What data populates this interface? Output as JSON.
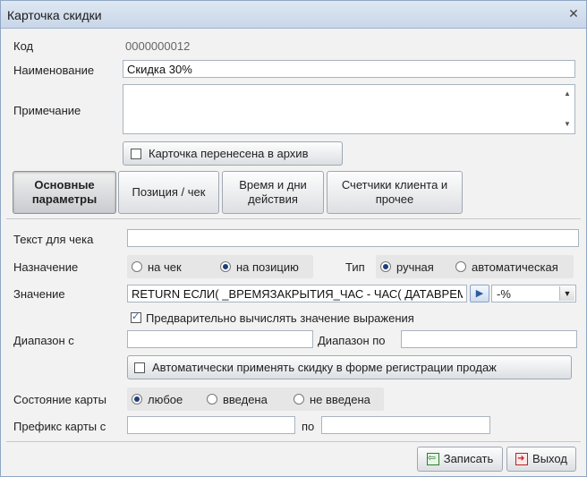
{
  "window": {
    "title": "Карточка скидки",
    "close": "✕"
  },
  "fields": {
    "code_label": "Код",
    "code_value": "0000000012",
    "name_label": "Наименование",
    "name_value": "Скидка 30%",
    "note_label": "Примечание",
    "archive_label": "Карточка перенесена в архив",
    "archive_checked": false
  },
  "tabs": [
    {
      "label": "Основные параметры",
      "active": true
    },
    {
      "label": "Позиция / чек",
      "active": false
    },
    {
      "label": "Время и дни действия",
      "active": false
    },
    {
      "label": "Счетчики клиента и прочее",
      "active": false
    }
  ],
  "params": {
    "receipt_text_label": "Текст для чека",
    "receipt_text_value": "",
    "purpose_label": "Назначение",
    "purpose_options": [
      "на чек",
      "на позицию"
    ],
    "purpose_selected": 1,
    "type_label": "Тип",
    "type_options": [
      "ручная",
      "автоматическая"
    ],
    "type_selected": 0,
    "value_label": "Значение",
    "value_expression": "RETURN ЕСЛИ( _ВРЕМЯЗАКРЫТИЯ_ЧАС - ЧАС( ДАТАВРЕМЯ(",
    "value_unit": "-%",
    "precompute_label": "Предварительно вычислять значение выражения",
    "precompute_checked": true,
    "range_from_label": "Диапазон с",
    "range_to_label": "Диапазон по",
    "auto_apply_label": "Автоматически применять скидку в форме регистрации продаж",
    "auto_apply_checked": false,
    "card_state_label": "Состояние карты",
    "card_state_options": [
      "любое",
      "введена",
      "не введена"
    ],
    "card_state_selected": 0,
    "card_prefix_label": "Префикс карты с",
    "card_prefix_to_label": "по"
  },
  "footer": {
    "save_label": "Записать",
    "exit_label": "Выход"
  }
}
